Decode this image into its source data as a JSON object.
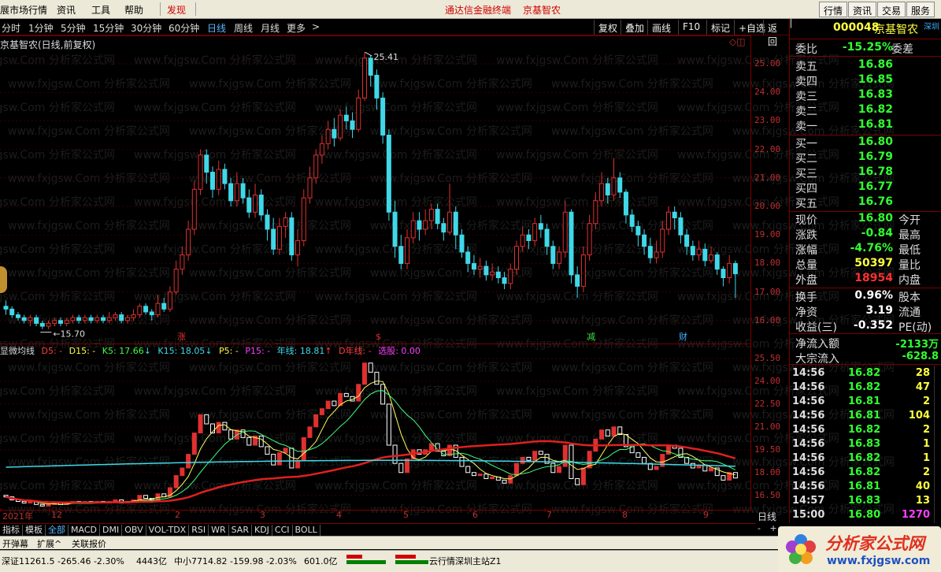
{
  "menubar": {
    "items": [
      "展市场行情",
      "资讯",
      "工具",
      "帮助"
    ],
    "discover": "发现",
    "title_left": "通达信金融终端",
    "title_right": "京基智农",
    "buttons": [
      "行情",
      "资讯",
      "交易",
      "服务"
    ]
  },
  "toolbar": {
    "periods": [
      "分时",
      "1分钟",
      "5分钟",
      "15分钟",
      "30分钟",
      "60分钟",
      "日线",
      "周线",
      "月线",
      "更多"
    ],
    "selected_period": "日线",
    "more_arrow": ">",
    "tools": [
      "复权",
      "叠加",
      "画线",
      "F10",
      "标记",
      "+自选",
      "返回"
    ]
  },
  "main_chart": {
    "title": "京基智农(日线,前复权)",
    "high_label": "25.41",
    "low_label": "15.70",
    "yticks": [
      "25.00",
      "24.00",
      "23.00",
      "22.00",
      "21.00",
      "20.00",
      "19.00",
      "18.00",
      "17.00",
      "16.00"
    ],
    "markers": [
      "涨",
      "$",
      "减",
      "财"
    ]
  },
  "indicator": {
    "name": "显微均线",
    "d5": "D5: -",
    "d15": "D15: -",
    "k5": "K5: 17.66",
    "k15": "K15: 18.05",
    "p5": "P5: -",
    "p15": "P15: -",
    "year": "年线: 18.81",
    "dyear": "D年线: -",
    "select": "选股: 0.00",
    "yticks": [
      "25.50",
      "24.00",
      "22.50",
      "21.00",
      "19.50",
      "18.00",
      "16.50"
    ]
  },
  "x_axis": {
    "labels": [
      "2021年",
      "12",
      "2",
      "3",
      "4",
      "5",
      "6",
      "7",
      "8",
      "9"
    ],
    "period": "日线"
  },
  "quote": {
    "code": "000048",
    "name": "京基智农",
    "market": "深圳",
    "weibi_label": "委比",
    "weibi": "-15.25%",
    "weicha_label": "委差",
    "sell": [
      {
        "label": "卖五",
        "price": "16.86"
      },
      {
        "label": "卖四",
        "price": "16.85"
      },
      {
        "label": "卖三",
        "price": "16.83"
      },
      {
        "label": "卖二",
        "price": "16.82"
      },
      {
        "label": "卖一",
        "price": "16.81"
      }
    ],
    "buy": [
      {
        "label": "买一",
        "price": "16.80"
      },
      {
        "label": "买二",
        "price": "16.79"
      },
      {
        "label": "买三",
        "price": "16.78"
      },
      {
        "label": "买四",
        "price": "16.77"
      },
      {
        "label": "买五",
        "price": "16.76"
      }
    ],
    "stats": [
      {
        "label": "现价",
        "value": "16.80",
        "label2": "今开",
        "color": "#30ff30"
      },
      {
        "label": "涨跌",
        "value": "-0.84",
        "label2": "最高",
        "color": "#30ff30"
      },
      {
        "label": "涨幅",
        "value": "-4.76%",
        "label2": "最低",
        "color": "#30ff30"
      },
      {
        "label": "总量",
        "value": "50397",
        "label2": "量比",
        "color": "#ffff40"
      },
      {
        "label": "外盘",
        "value": "18954",
        "label2": "内盘",
        "color": "#ff3030"
      }
    ],
    "stats2": [
      {
        "label": "换手",
        "value": "0.96%",
        "label2": "股本",
        "color": "#ffffff"
      },
      {
        "label": "净资",
        "value": "3.19",
        "label2": "流通",
        "color": "#ffffff"
      },
      {
        "label": "收益(三)",
        "value": "-0.352",
        "label2": "PE(动)",
        "color": "#ffffff"
      }
    ],
    "flow": [
      {
        "label": "净流入额",
        "value": "-2133万"
      },
      {
        "label": "大宗流入",
        "value": "-628.8"
      }
    ]
  },
  "ticks": [
    {
      "time": "14:56",
      "price": "16.82",
      "vol": "28",
      "vcolor": "#ffff40"
    },
    {
      "time": "14:56",
      "price": "16.82",
      "vol": "47",
      "vcolor": "#ffff40"
    },
    {
      "time": "14:56",
      "price": "16.81",
      "vol": "2",
      "vcolor": "#ffff40"
    },
    {
      "time": "14:56",
      "price": "16.81",
      "vol": "104",
      "vcolor": "#ffff40"
    },
    {
      "time": "14:56",
      "price": "16.82",
      "vol": "2",
      "vcolor": "#ffff40"
    },
    {
      "time": "14:56",
      "price": "16.83",
      "vol": "1",
      "vcolor": "#ffff40"
    },
    {
      "time": "14:56",
      "price": "16.82",
      "vol": "1",
      "vcolor": "#ffff40"
    },
    {
      "time": "14:56",
      "price": "16.82",
      "vol": "2",
      "vcolor": "#ffff40"
    },
    {
      "time": "14:56",
      "price": "16.81",
      "vol": "40",
      "vcolor": "#ffff40"
    },
    {
      "time": "14:57",
      "price": "16.83",
      "vol": "13",
      "vcolor": "#ffff40"
    },
    {
      "time": "15:00",
      "price": "16.80",
      "vol": "1270",
      "vcolor": "#ff40ff"
    }
  ],
  "tabs": [
    "指标",
    "模板",
    "全部",
    "MACD",
    "DMI",
    "OBV",
    "VOL-TDX",
    "RSI",
    "WR",
    "SAR",
    "KDJ",
    "CCI",
    "BOLL"
  ],
  "selected_tab": "全部",
  "subbar": {
    "items": [
      "开弹幕",
      "扩展^",
      "关联报价"
    ],
    "nav": [
      "-",
      "+"
    ]
  },
  "status": {
    "sz": "深证11261.5 -265.46 -2.30%",
    "sz_amt": "4443亿",
    "zx": "中小7714.82 -159.98 -2.03%",
    "zx_amt": "601.0亿",
    "server": "云行情深圳主站Z1"
  },
  "watermark": {
    "text": "www.fxjgsw.Com 分析家公式网",
    "logo": "分析家公式网",
    "url": "www.fxjgsw.com"
  },
  "colors": {
    "up": "#e03030",
    "down": "#40d8e8",
    "frame": "#7a0000",
    "green": "#30ff30",
    "yellow": "#ffff40"
  },
  "chart_data": {
    "type": "candlestick",
    "title": "京基智农(日线,前复权)",
    "ylim": [
      15.5,
      25.6
    ],
    "candles": [
      [
        16.5,
        16.4,
        16.7,
        16.2
      ],
      [
        16.4,
        16.2,
        16.5,
        16.1
      ],
      [
        16.2,
        16.1,
        16.3,
        16.0
      ],
      [
        16.1,
        16.0,
        16.2,
        15.9
      ],
      [
        16.0,
        16.1,
        16.2,
        15.8
      ],
      [
        16.1,
        15.9,
        16.2,
        15.8
      ],
      [
        15.9,
        15.8,
        16.0,
        15.7
      ],
      [
        15.8,
        15.9,
        16.0,
        15.7
      ],
      [
        15.9,
        16.0,
        16.1,
        15.8
      ],
      [
        16.0,
        15.9,
        16.1,
        15.8
      ],
      [
        15.9,
        16.0,
        16.1,
        15.8
      ],
      [
        16.0,
        16.1,
        16.2,
        15.9
      ],
      [
        16.1,
        16.0,
        16.2,
        15.9
      ],
      [
        16.0,
        16.1,
        16.2,
        15.9
      ],
      [
        16.1,
        16.0,
        16.2,
        15.9
      ],
      [
        16.0,
        16.1,
        16.2,
        15.9
      ],
      [
        16.1,
        16.0,
        16.2,
        15.9
      ],
      [
        16.0,
        16.1,
        16.3,
        15.9
      ],
      [
        16.1,
        16.2,
        16.3,
        16.0
      ],
      [
        16.2,
        16.0,
        16.3,
        15.9
      ],
      [
        16.0,
        16.1,
        16.2,
        15.9
      ],
      [
        16.1,
        16.2,
        16.4,
        16.0
      ],
      [
        16.2,
        16.5,
        16.6,
        16.1
      ],
      [
        16.5,
        16.3,
        16.6,
        16.2
      ],
      [
        16.3,
        16.2,
        16.4,
        16.0
      ],
      [
        16.2,
        16.6,
        16.9,
        16.1
      ],
      [
        16.6,
        16.4,
        16.8,
        16.3
      ],
      [
        16.4,
        17.0,
        17.2,
        16.3
      ],
      [
        17.0,
        17.8,
        18.1,
        16.9
      ],
      [
        17.8,
        18.3,
        18.6,
        17.6
      ],
      [
        18.3,
        19.2,
        19.5,
        18.1
      ],
      [
        19.2,
        20.6,
        20.9,
        19.0
      ],
      [
        20.6,
        21.8,
        22.0,
        20.4
      ],
      [
        21.8,
        21.2,
        22.0,
        20.8
      ],
      [
        21.2,
        20.6,
        21.4,
        20.3
      ],
      [
        20.6,
        21.3,
        21.6,
        20.4
      ],
      [
        21.3,
        20.8,
        21.5,
        20.6
      ],
      [
        20.8,
        20.2,
        21.0,
        20.0
      ],
      [
        20.2,
        20.8,
        21.2,
        20.0
      ],
      [
        20.8,
        20.3,
        21.0,
        20.1
      ],
      [
        20.3,
        19.8,
        20.6,
        19.6
      ],
      [
        19.8,
        20.4,
        20.8,
        19.6
      ],
      [
        20.4,
        19.7,
        20.6,
        19.5
      ],
      [
        19.7,
        19.2,
        19.9,
        18.8
      ],
      [
        19.2,
        18.5,
        19.6,
        18.3
      ],
      [
        18.5,
        19.3,
        19.6,
        18.3
      ],
      [
        19.3,
        19.6,
        19.8,
        18.9
      ],
      [
        19.6,
        18.3,
        19.8,
        18.1
      ],
      [
        18.3,
        18.8,
        19.2,
        17.9
      ],
      [
        18.8,
        20.3,
        20.6,
        18.6
      ],
      [
        20.3,
        21.0,
        21.4,
        20.1
      ],
      [
        21.0,
        21.8,
        22.0,
        20.8
      ],
      [
        21.8,
        22.2,
        22.5,
        21.5
      ],
      [
        22.2,
        22.7,
        23.0,
        22.0
      ],
      [
        22.7,
        22.4,
        23.1,
        22.1
      ],
      [
        22.4,
        23.2,
        23.4,
        22.3
      ],
      [
        23.2,
        23.0,
        23.5,
        22.7
      ],
      [
        23.0,
        22.7,
        23.3,
        22.4
      ],
      [
        22.7,
        23.8,
        24.1,
        22.6
      ],
      [
        23.8,
        25.2,
        25.41,
        23.7
      ],
      [
        25.2,
        24.6,
        25.3,
        24.2
      ],
      [
        24.6,
        23.8,
        24.8,
        23.4
      ],
      [
        23.8,
        22.5,
        24.0,
        22.2
      ],
      [
        22.5,
        19.8,
        22.7,
        19.5
      ],
      [
        19.8,
        18.6,
        20.2,
        18.2
      ],
      [
        18.6,
        18.0,
        19.0,
        17.8
      ],
      [
        18.0,
        18.9,
        19.2,
        17.8
      ],
      [
        18.9,
        19.5,
        19.8,
        18.7
      ],
      [
        19.5,
        19.2,
        19.8,
        18.8
      ],
      [
        19.2,
        19.5,
        19.9,
        19.0
      ],
      [
        19.5,
        19.9,
        20.1,
        19.2
      ],
      [
        19.9,
        19.4,
        20.1,
        19.2
      ],
      [
        19.4,
        19.1,
        19.6,
        18.8
      ],
      [
        19.1,
        19.8,
        20.8,
        19.0
      ],
      [
        19.8,
        19.0,
        20.0,
        18.5
      ],
      [
        19.0,
        18.4,
        19.2,
        18.2
      ],
      [
        18.4,
        18.0,
        18.6,
        17.7
      ],
      [
        18.0,
        17.8,
        18.3,
        17.6
      ],
      [
        17.8,
        17.9,
        18.2,
        17.5
      ],
      [
        17.9,
        17.6,
        18.1,
        17.4
      ],
      [
        17.6,
        17.7,
        18.0,
        17.4
      ],
      [
        17.7,
        17.5,
        17.9,
        17.3
      ],
      [
        17.5,
        17.3,
        17.7,
        17.1
      ],
      [
        17.3,
        17.8,
        18.0,
        17.1
      ],
      [
        17.8,
        18.6,
        18.8,
        17.6
      ],
      [
        18.6,
        19.0,
        19.3,
        18.4
      ],
      [
        19.0,
        18.8,
        19.2,
        18.5
      ],
      [
        18.8,
        19.4,
        19.6,
        18.6
      ],
      [
        19.4,
        19.2,
        19.7,
        18.9
      ],
      [
        19.2,
        18.6,
        19.4,
        18.3
      ],
      [
        18.6,
        18.0,
        18.8,
        17.8
      ],
      [
        18.0,
        18.4,
        18.6,
        17.8
      ],
      [
        18.4,
        19.8,
        20.2,
        18.2
      ],
      [
        19.8,
        17.6,
        19.9,
        17.3
      ],
      [
        17.6,
        17.2,
        17.9,
        16.8
      ],
      [
        17.2,
        18.3,
        18.6,
        17.0
      ],
      [
        18.3,
        19.4,
        19.7,
        18.1
      ],
      [
        19.4,
        20.2,
        20.5,
        19.2
      ],
      [
        20.2,
        20.8,
        21.2,
        20.0
      ],
      [
        20.8,
        20.4,
        21.0,
        20.1
      ],
      [
        20.4,
        21.0,
        21.7,
        20.2
      ],
      [
        21.0,
        20.5,
        21.2,
        20.3
      ],
      [
        20.5,
        19.7,
        20.6,
        19.4
      ],
      [
        19.7,
        19.3,
        19.9,
        19.1
      ],
      [
        19.3,
        19.0,
        19.5,
        18.6
      ],
      [
        19.0,
        18.6,
        19.2,
        18.3
      ],
      [
        18.6,
        18.2,
        18.9,
        18.0
      ],
      [
        18.2,
        18.4,
        18.8,
        18.0
      ],
      [
        18.4,
        19.2,
        19.5,
        18.2
      ],
      [
        19.2,
        19.8,
        20.0,
        19.0
      ],
      [
        19.8,
        19.6,
        20.0,
        19.2
      ],
      [
        19.6,
        19.0,
        19.8,
        18.7
      ],
      [
        19.0,
        18.6,
        19.2,
        18.3
      ],
      [
        18.6,
        18.3,
        18.8,
        18.1
      ],
      [
        18.3,
        18.5,
        18.8,
        18.1
      ],
      [
        18.5,
        18.1,
        18.7,
        17.9
      ],
      [
        18.1,
        18.3,
        18.6,
        18.0
      ],
      [
        18.3,
        17.8,
        18.4,
        17.6
      ],
      [
        17.8,
        17.5,
        17.9,
        17.2
      ],
      [
        17.5,
        18.0,
        18.3,
        17.3
      ],
      [
        18.0,
        17.64,
        18.1,
        16.8
      ]
    ]
  }
}
